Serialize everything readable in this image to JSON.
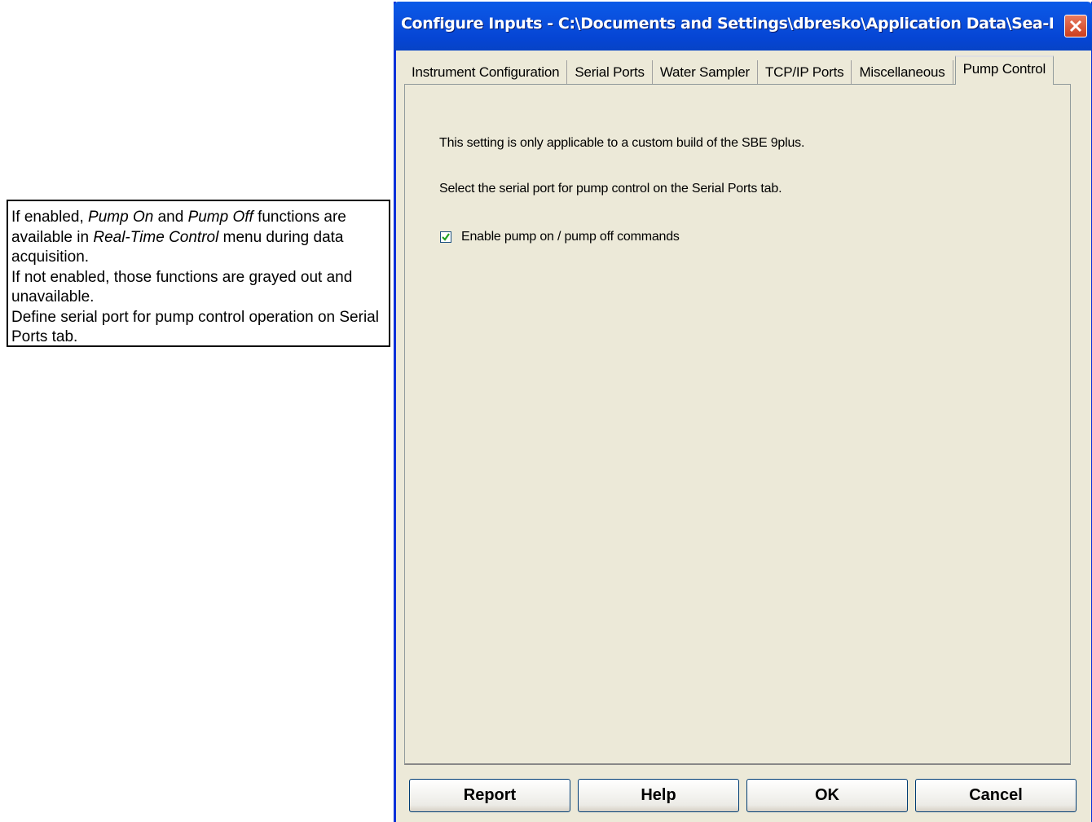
{
  "window": {
    "title": "Configure Inputs - C:\\Documents and Settings\\dbresko\\Application Data\\Sea-Bir..."
  },
  "tabs": [
    {
      "label": "Instrument Configuration"
    },
    {
      "label": "Serial Ports"
    },
    {
      "label": "Water Sampler"
    },
    {
      "label": "TCP/IP Ports"
    },
    {
      "label": "Miscellaneous"
    },
    {
      "label": "Pump Control",
      "active": true
    }
  ],
  "panel": {
    "info_line_1": "This setting is only applicable to a custom build of the SBE 9plus.",
    "info_line_2": "Select the serial port for pump control on the Serial Ports tab.",
    "checkbox_label": "Enable pump on / pump off commands",
    "checkbox_checked": true
  },
  "buttons": {
    "report": "Report",
    "help": "Help",
    "ok": "OK",
    "cancel": "Cancel"
  },
  "callout": {
    "line1_a": "If enabled, ",
    "line1_b": "Pump On",
    "line1_c": " and ",
    "line1_d": "Pump Off",
    "line1_e": " functions are available in ",
    "line1_f": "Real-Time Control",
    "line1_g": " menu during data acquisition.",
    "line2": "If not enabled, those functions are grayed out and unavailable.",
    "line3": "Define serial port for pump control operation on Serial Ports tab."
  },
  "colors": {
    "titlebar": "#0a4fdd",
    "dialog_bg": "#ece9d8",
    "close_button": "#cc3e1d"
  }
}
